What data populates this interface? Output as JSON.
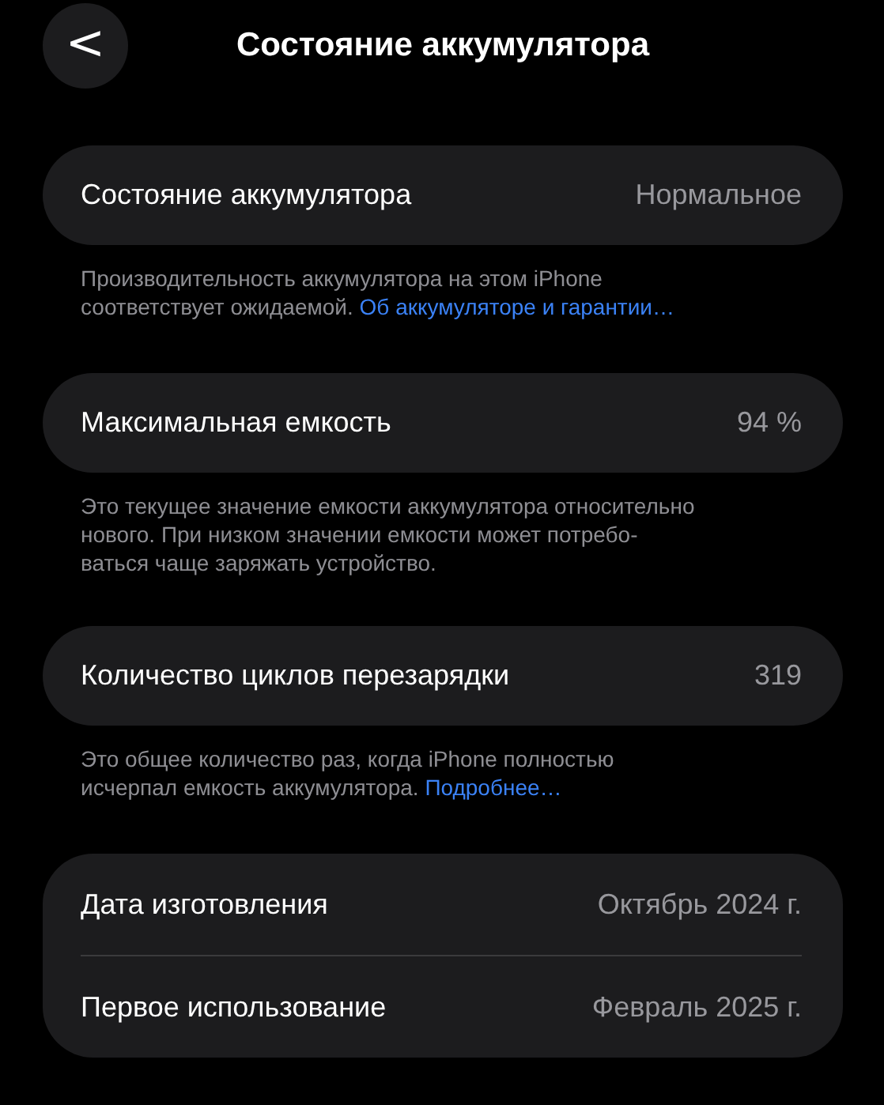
{
  "header": {
    "back": "<",
    "title": "Состояние аккумулятора"
  },
  "sections": [
    {
      "rows": [
        {
          "label": "Состояние аккумулятора",
          "value": "Нормальное"
        }
      ],
      "footnote": {
        "text": "Производительность аккумулятора на этом iPhone\nсоответствует ожидаемой.",
        "link": "Об аккумуляторе и гарантии…"
      }
    },
    {
      "rows": [
        {
          "label": "Максимальная емкость",
          "value": "94 %"
        }
      ],
      "footnote": {
        "text": "Это текущее значение емкости аккумулятора относительно\nнового. При низком значении емкости может потребо-\nваться чаще заряжать устройство."
      }
    },
    {
      "rows": [
        {
          "label": "Количество циклов перезарядки",
          "value": "319"
        }
      ],
      "footnote": {
        "text": "Это общее количество раз, когда iPhone полностью\nисчерпал емкость аккумулятора.",
        "link": "Подробнее…"
      }
    },
    {
      "rows": [
        {
          "label": "Дата изготовления",
          "value": "Октябрь 2024 г."
        },
        {
          "label": "Первое использование",
          "value": "Февраль 2025 г."
        }
      ]
    }
  ]
}
